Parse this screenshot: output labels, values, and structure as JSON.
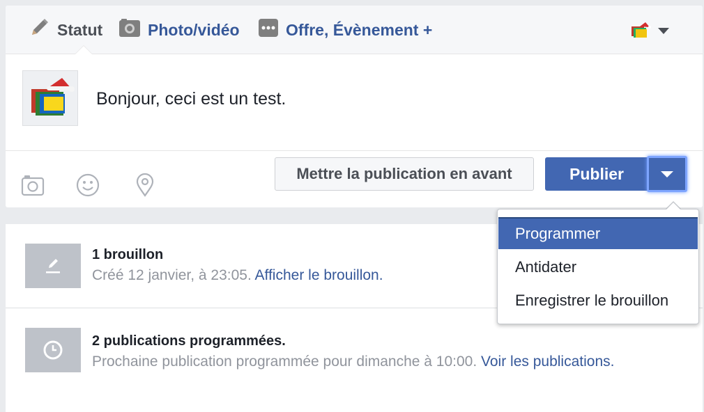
{
  "composer": {
    "tabs": [
      {
        "label": "Statut",
        "icon": "pencil-icon"
      },
      {
        "label": "Photo/vidéo",
        "icon": "camera-icon"
      },
      {
        "label": "Offre, Évènement +",
        "icon": "more-icon"
      }
    ],
    "post_text": "Bonjour, ceci est un test.",
    "boost_label": "Mettre la publication en avant",
    "publish_label": "Publier",
    "action_icons": [
      "camera-icon",
      "smiley-icon",
      "location-pin-icon"
    ]
  },
  "publish_menu": {
    "items": [
      "Programmer",
      "Antidater",
      "Enregistrer le brouillon"
    ],
    "active_index": 0
  },
  "drafts": {
    "title": "1 brouillon",
    "desc": "Créé 12 janvier, à 23:05.",
    "link": "Afficher le brouillon."
  },
  "scheduled": {
    "title": "2 publications programmées.",
    "desc": "Prochaine publication programmée pour dimanche à 10:00.",
    "link": "Voir les publications."
  },
  "colors": {
    "accent": "#4267b2",
    "link": "#365899",
    "muted_text": "#90949c",
    "background": "#e9ebee"
  }
}
